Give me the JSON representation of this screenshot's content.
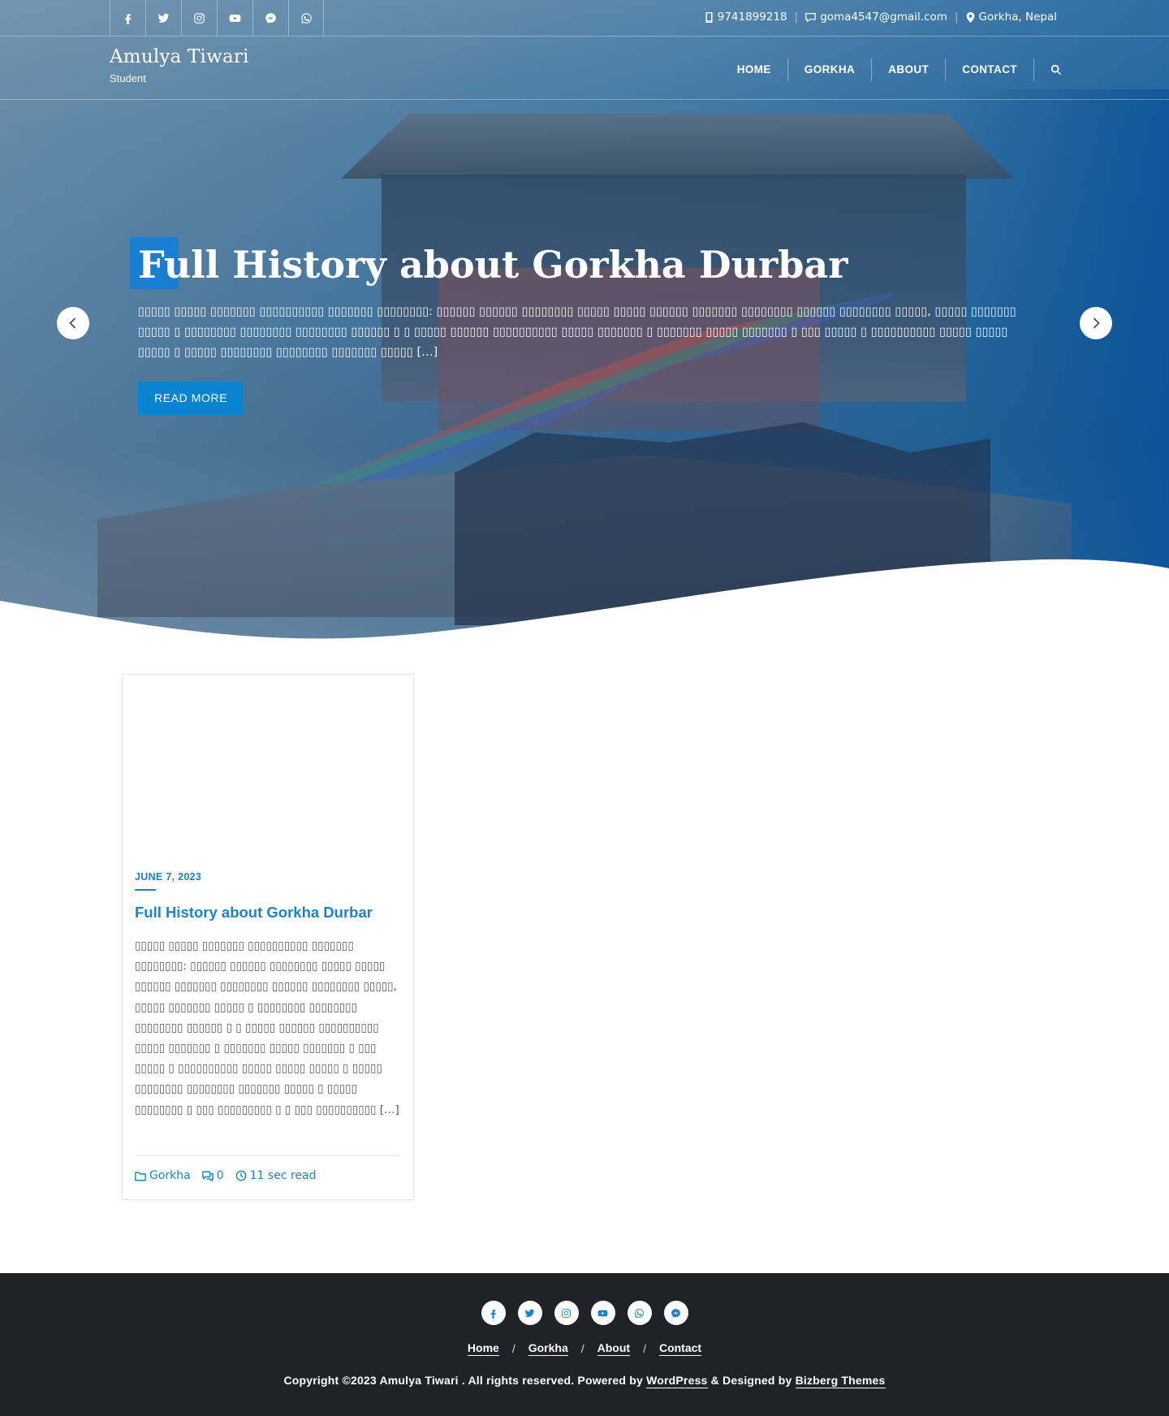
{
  "topbar": {
    "social": [
      {
        "icon": "facebook-icon"
      },
      {
        "icon": "twitter-icon"
      },
      {
        "icon": "instagram-icon"
      },
      {
        "icon": "youtube-icon"
      },
      {
        "icon": "messenger-icon"
      },
      {
        "icon": "whatsapp-icon"
      }
    ],
    "phone": "9741899218",
    "email": "goma4547@gmail.com",
    "location": "Gorkha, Nepal"
  },
  "header": {
    "site_title": "Amulya Tiwari",
    "tagline": "Student",
    "nav": [
      "Home",
      "Gorkha",
      "About",
      "Contact"
    ],
    "search_icon": "search-icon"
  },
  "slider": {
    "title": "Full History about Gorkha Durbar",
    "excerpt": "▯▯▯▯▯ ▯▯▯▯▯ ▯▯▯▯▯▯▯ ▯▯▯▯▯▯▯▯▯▯ ▯▯▯▯▯▯▯ ▯▯▯▯▯▯▯▯: ▯▯▯▯▯▯ ▯▯▯▯▯▯ ▯▯▯▯▯▯▯▯ ▯▯▯▯▯ ▯▯▯▯▯ ▯▯▯▯▯▯ ▯▯▯▯▯▯▯ ▯▯▯▯▯▯▯▯ ▯▯▯▯▯▯ ▯▯▯▯▯▯▯▯ ▯▯▯▯▯, ▯▯▯▯▯ ▯▯▯▯▯▯▯ ▯▯▯▯▯ ▯ ▯▯▯▯▯▯▯▯ ▯▯▯▯▯▯▯▯ ▯▯▯▯▯▯▯▯ ▯▯▯▯▯▯ ▯ ▯ ▯▯▯▯▯ ▯▯▯▯▯▯ ▯▯▯▯▯▯▯▯▯▯ ▯▯▯▯▯ ▯▯▯▯▯▯▯ ▯ ▯▯▯▯▯▯▯ ▯▯▯▯▯ ▯▯▯▯▯▯▯ ▯ ▯▯▯ ▯▯▯▯▯ ▯ ▯▯▯▯▯▯▯▯▯▯ ▯▯▯▯▯ ▯▯▯▯▯ ▯▯▯▯▯ ▯ ▯▯▯▯▯ ▯▯▯▯▯▯▯▯ ▯▯▯▯▯▯▯▯ ▯▯▯▯▯▯▯ ▯▯▯▯▯ […]",
    "button": "Read More",
    "prev_icon": "chevron-left-icon",
    "next_icon": "chevron-right-icon"
  },
  "post": {
    "date": "June 7, 2023",
    "title": "Full History about Gorkha Durbar",
    "excerpt": "▯▯▯▯▯ ▯▯▯▯▯ ▯▯▯▯▯▯▯ ▯▯▯▯▯▯▯▯▯▯ ▯▯▯▯▯▯▯ ▯▯▯▯▯▯▯▯: ▯▯▯▯▯▯ ▯▯▯▯▯▯ ▯▯▯▯▯▯▯▯ ▯▯▯▯▯ ▯▯▯▯▯ ▯▯▯▯▯▯ ▯▯▯▯▯▯▯ ▯▯▯▯▯▯▯▯ ▯▯▯▯▯▯ ▯▯▯▯▯▯▯▯ ▯▯▯▯▯, ▯▯▯▯▯ ▯▯▯▯▯▯▯ ▯▯▯▯▯ ▯ ▯▯▯▯▯▯▯▯ ▯▯▯▯▯▯▯▯ ▯▯▯▯▯▯▯▯ ▯▯▯▯▯▯ ▯ ▯ ▯▯▯▯▯ ▯▯▯▯▯▯ ▯▯▯▯▯▯▯▯▯▯ ▯▯▯▯▯ ▯▯▯▯▯▯▯ ▯ ▯▯▯▯▯▯▯ ▯▯▯▯▯ ▯▯▯▯▯▯▯ ▯ ▯▯▯ ▯▯▯▯▯ ▯ ▯▯▯▯▯▯▯▯▯▯ ▯▯▯▯▯ ▯▯▯▯▯ ▯▯▯▯▯ ▯ ▯▯▯▯▯ ▯▯▯▯▯▯▯▯ ▯▯▯▯▯▯▯▯ ▯▯▯▯▯▯▯ ▯▯▯▯▯ ▯ ▯▯▯▯▯ ▯▯▯▯▯▯▯▯ ▯ ▯▯▯ ▯▯▯▯▯▯▯▯▯ ▯ ▯ ▯▯▯ ▯▯▯▯▯▯▯▯▯▯ […]",
    "category": "Gorkha",
    "comments": "0",
    "read_time": "11 sec read"
  },
  "footer": {
    "social": [
      {
        "icon": "facebook-icon"
      },
      {
        "icon": "twitter-icon"
      },
      {
        "icon": "instagram-icon"
      },
      {
        "icon": "youtube-icon"
      },
      {
        "icon": "whatsapp-icon"
      },
      {
        "icon": "messenger-icon"
      }
    ],
    "nav": [
      "Home",
      "Gorkha",
      "About",
      "Contact"
    ],
    "copyright_prefix": "Copyright ©2023 Amulya Tiwari . All rights reserved. Powered by ",
    "powered_link": "WordPress",
    "designed_by": " & Designed by ",
    "designer_link": "Bizberg Themes"
  },
  "colors": {
    "accent": "#0a84d0",
    "footer_bg": "#202227"
  }
}
